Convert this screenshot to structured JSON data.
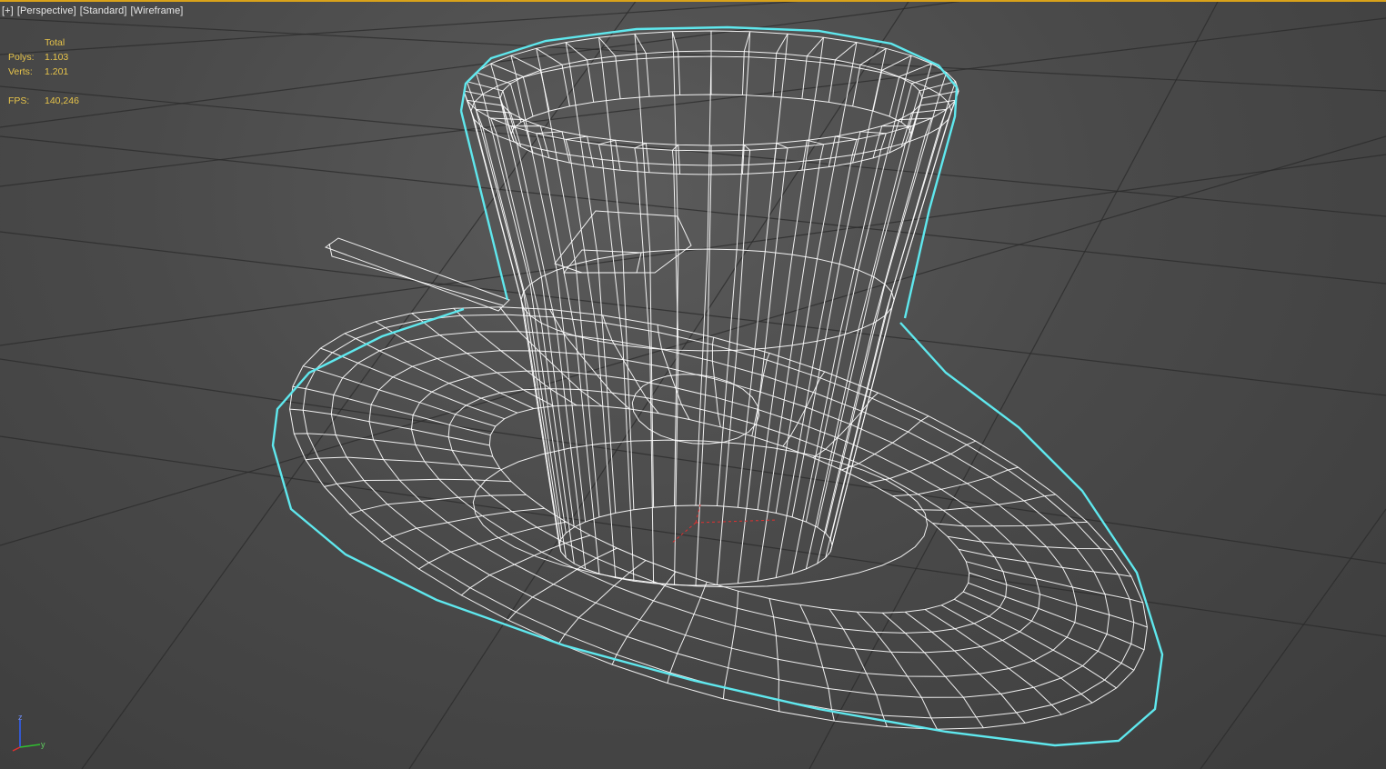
{
  "viewport": {
    "labels": {
      "plus": "[+]",
      "view": "[Perspective]",
      "shading_style": "[Standard]",
      "render_mode": "[Wireframe]"
    },
    "stats": {
      "total_label": "Total",
      "polys_label": "Polys:",
      "polys_value": "1.103",
      "verts_label": "Verts:",
      "verts_value": "1.201",
      "fps_label": "FPS:",
      "fps_value": "140,246"
    },
    "gizmo": {
      "z_label": "z",
      "y_label": "y"
    }
  },
  "colors": {
    "selection_outline": "#5fe8ee",
    "wire": "#ffffff",
    "grid": "#2a2a2a",
    "stats_text": "#e7c44a",
    "axis_x": "#e03030",
    "axis_y": "#30c030",
    "axis_z": "#3060ff"
  },
  "scene": {
    "object": "cup-and-saucer-with-spoon",
    "icons": [
      "axis-gizmo-icon",
      "world-origin-icon"
    ]
  }
}
